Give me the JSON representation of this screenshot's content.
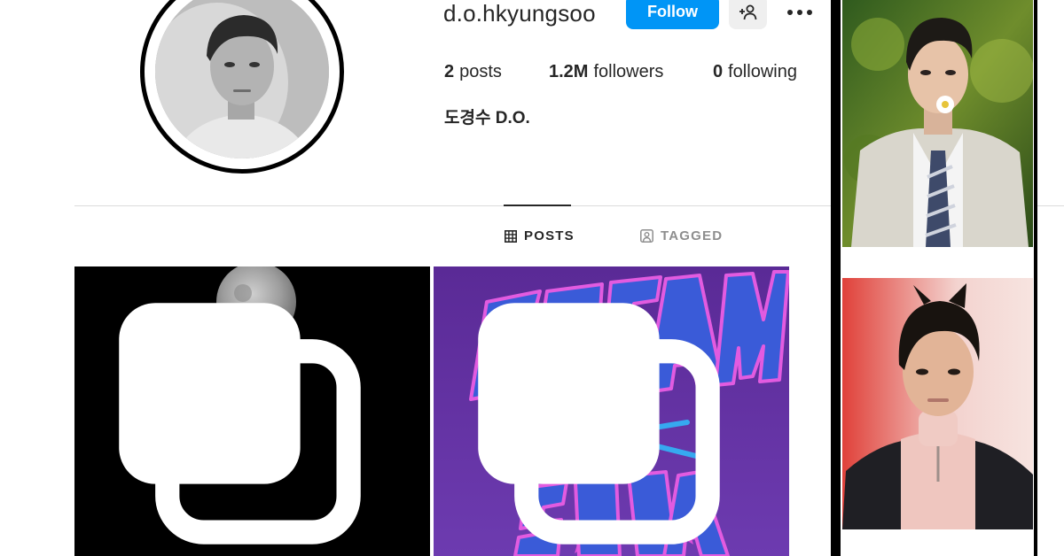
{
  "profile": {
    "username": "d.o.hkyungsoo",
    "follow_label": "Follow",
    "full_name": "도경수 D.O."
  },
  "stats": {
    "posts_count": "2",
    "posts_label": "posts",
    "followers_count": "1.2M",
    "followers_label": "followers",
    "following_count": "0",
    "following_label": "following"
  },
  "tabs": [
    {
      "label": "POSTS",
      "icon": "grid-icon",
      "active": true
    },
    {
      "label": "TAGGED",
      "icon": "tagged-icon",
      "active": false
    }
  ],
  "posts": [
    {
      "description_icon": "moon",
      "multi": true
    },
    {
      "description_icon": "cream-soda",
      "multi": true
    }
  ],
  "colors": {
    "follow_blue": "#0095f6",
    "text_primary": "#262626",
    "text_secondary": "#8e8e8e",
    "divider": "#dbdbdb",
    "soda_purple": "#6a2ba8"
  }
}
